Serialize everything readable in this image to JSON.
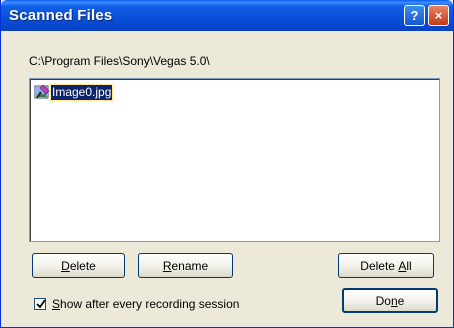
{
  "window": {
    "title": "Scanned Files",
    "help_glyph": "?",
    "close_glyph": "×"
  },
  "path": "C:\\Program Files\\Sony\\Vegas 5.0\\",
  "files": [
    {
      "name": "Image0.jpg",
      "icon": "image-file-icon",
      "selected": true
    }
  ],
  "buttons": {
    "delete": {
      "pre": "",
      "accel": "D",
      "post": "elete"
    },
    "rename": {
      "pre": "",
      "accel": "R",
      "post": "ename"
    },
    "delete_all": {
      "pre": "Delete ",
      "accel": "A",
      "post": "ll"
    },
    "done": {
      "pre": "Do",
      "accel": "n",
      "post": "e"
    }
  },
  "show_after": {
    "checked": true,
    "pre": "",
    "accel": "S",
    "post": "how after every recording session"
  },
  "colors": {
    "title_bar": "#0a4fd8",
    "dialog_bg": "#ece9d8",
    "selection": "#0a246a"
  }
}
